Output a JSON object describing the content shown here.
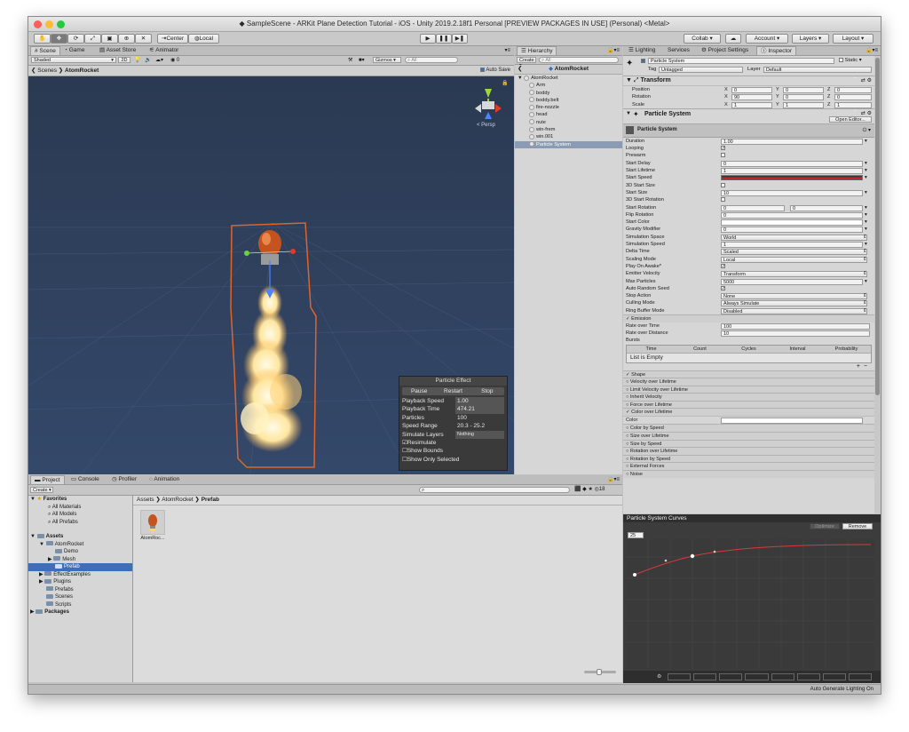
{
  "window": {
    "title": "SampleScene - ARKit Plane Detection Tutorial - iOS - Unity 2019.2.18f1 Personal [PREVIEW PACKAGES IN USE] (Personal) <Metal>"
  },
  "toolbar": {
    "pivot_label": "Center",
    "space_label": "Local",
    "collab_label": "Collab ▾",
    "account_label": "Account",
    "layers_label": "Layers",
    "layout_label": "Layout"
  },
  "scene_tabs": [
    "Scene",
    "Game",
    "Asset Store",
    "Animator"
  ],
  "scene_toolbar": {
    "shading": "Shaded",
    "mode_2d": "2D",
    "gizmos": "Gizmos",
    "search_placeholder": "All",
    "auto_save": "Auto Save"
  },
  "scene_breadcrumb": {
    "root": "Scenes",
    "current": "AtomRocket"
  },
  "scene_view": {
    "persp_label": "< Persp",
    "colors": {
      "background": "#2f3f58",
      "bounds": "#e2632a"
    }
  },
  "particle_effect": {
    "title": "Particle Effect",
    "buttons": [
      "Pause",
      "Restart",
      "Stop"
    ],
    "rows": [
      {
        "label": "Playback Speed",
        "value": "1.00"
      },
      {
        "label": "Playback Time",
        "value": "474.21"
      },
      {
        "label": "Particles",
        "value": "100"
      },
      {
        "label": "Speed Range",
        "value": "20.3 - 25.2"
      },
      {
        "label": "Simulate Layers",
        "value": "Nothing"
      }
    ],
    "toggles": [
      {
        "label": "Resimulate",
        "checked": true
      },
      {
        "label": "Show Bounds",
        "checked": false
      },
      {
        "label": "Show Only Selected",
        "checked": false
      }
    ]
  },
  "hierarchy": {
    "tab": "Hierarchy",
    "create": "Create ▾",
    "search_placeholder": "All",
    "scene_header": "AtomRocket",
    "root": "AtomRocket",
    "children": [
      "Arm",
      "boddy",
      "boddy.belt",
      "fire-nozzle",
      "head",
      "nute",
      "win-frem",
      "win.001",
      "Particle System"
    ],
    "selected": "Particle System"
  },
  "inspector_tabs": [
    "Lighting",
    "Services",
    "Project Settings",
    "Inspector"
  ],
  "inspector": {
    "object_name": "Particle System",
    "static_label": "Static ▾",
    "tag_label": "Tag",
    "tag_value": "Untagged",
    "layer_label": "Layer",
    "layer_value": "Default",
    "transform": {
      "title": "Transform",
      "rows": [
        {
          "label": "Position",
          "x": "0",
          "y": "0",
          "z": "0"
        },
        {
          "label": "Rotation",
          "x": "90",
          "y": "0",
          "z": "0"
        },
        {
          "label": "Scale",
          "x": "1",
          "y": "1",
          "z": "1"
        }
      ]
    },
    "particle_system_title": "Particle System",
    "open_editor": "Open Editor...",
    "main_module": "Particle System",
    "properties": [
      {
        "label": "Duration",
        "value": "1.00",
        "kind": "field"
      },
      {
        "label": "Looping",
        "value": "✓",
        "kind": "check"
      },
      {
        "label": "Prewarm",
        "value": "",
        "kind": "check"
      },
      {
        "label": "Start Delay",
        "value": "0",
        "kind": "field"
      },
      {
        "label": "Start Lifetime",
        "value": "1",
        "kind": "field"
      },
      {
        "label": "Start Speed",
        "value": "",
        "kind": "curve"
      },
      {
        "label": "3D Start Size",
        "value": "",
        "kind": "check"
      },
      {
        "label": "Start Size",
        "value": "10",
        "kind": "field"
      },
      {
        "label": "3D Start Rotation",
        "value": "",
        "kind": "check"
      },
      {
        "label": "Start Rotation",
        "value": "0",
        "value2": "0",
        "kind": "field2"
      },
      {
        "label": "Flip Rotation",
        "value": "0",
        "kind": "field"
      },
      {
        "label": "Start Color",
        "value": "",
        "kind": "color"
      },
      {
        "label": "Gravity Modifier",
        "value": "0",
        "kind": "field"
      },
      {
        "label": "Simulation Space",
        "value": "World",
        "kind": "drop"
      },
      {
        "label": "Simulation Speed",
        "value": "1",
        "kind": "field"
      },
      {
        "label": "Delta Time",
        "value": "Scaled",
        "kind": "drop"
      },
      {
        "label": "Scaling Mode",
        "value": "Local",
        "kind": "drop"
      },
      {
        "label": "Play On Awake*",
        "value": "✓",
        "kind": "check"
      },
      {
        "label": "Emitter Velocity",
        "value": "Transform",
        "kind": "drop"
      },
      {
        "label": "Max Particles",
        "value": "5000",
        "kind": "field"
      },
      {
        "label": "Auto Random Seed",
        "value": "✓",
        "kind": "check"
      },
      {
        "label": "Stop Action",
        "value": "None",
        "kind": "drop"
      },
      {
        "label": "Culling Mode",
        "value": "Always Simulate",
        "kind": "drop"
      },
      {
        "label": "Ring Buffer Mode",
        "value": "Disabled",
        "kind": "drop"
      }
    ],
    "emission": {
      "title": "Emission",
      "rows": [
        {
          "label": "Rate over Time",
          "value": "100"
        },
        {
          "label": "Rate over Distance",
          "value": "10"
        }
      ],
      "bursts_label": "Bursts",
      "bursts_columns": [
        "Time",
        "Count",
        "Cycles",
        "Interval",
        "Probability"
      ],
      "bursts_empty": "List is Empty"
    },
    "modules": [
      {
        "label": "Shape",
        "checked": true
      },
      {
        "label": "Velocity over Lifetime",
        "checked": false
      },
      {
        "label": "Limit Velocity over Lifetime",
        "checked": false
      },
      {
        "label": "Inherit Velocity",
        "checked": false
      },
      {
        "label": "Force over Lifetime",
        "checked": false
      },
      {
        "label": "Color over Lifetime",
        "checked": true
      }
    ],
    "color_label": "Color",
    "modules2": [
      "Color by Speed",
      "Size over Lifetime",
      "Size by Speed",
      "Rotation over Lifetime",
      "Rotation by Speed",
      "External Forces",
      "Noise"
    ]
  },
  "curves": {
    "title": "Particle System Curves",
    "optimize": "Optimize",
    "remove": "Remove",
    "multiplier": "25",
    "status": "Auto Generate Lighting On"
  },
  "project": {
    "tabs": [
      "Project",
      "Console",
      "Profiler",
      "Animation"
    ],
    "create": "Create ▾",
    "count": "18",
    "favorites": "Favorites",
    "favorite_items": [
      "All Materials",
      "All Models",
      "All Prefabs"
    ],
    "assets": "Assets",
    "tree": [
      {
        "label": "AtomRocket",
        "indent": 1
      },
      {
        "label": "Demo",
        "indent": 2
      },
      {
        "label": "Mesh",
        "indent": 2
      },
      {
        "label": "Prefab",
        "indent": 2
      },
      {
        "label": "EffectExamples",
        "indent": 1
      },
      {
        "label": "Plugins",
        "indent": 1
      },
      {
        "label": "Prefabs",
        "indent": 1
      },
      {
        "label": "Scenes",
        "indent": 1
      },
      {
        "label": "Scripts",
        "indent": 1
      }
    ],
    "packages": "Packages",
    "breadcrumb": [
      "Assets",
      "AtomRocket",
      "Prefab"
    ],
    "asset_item": "AtomRoc..."
  }
}
